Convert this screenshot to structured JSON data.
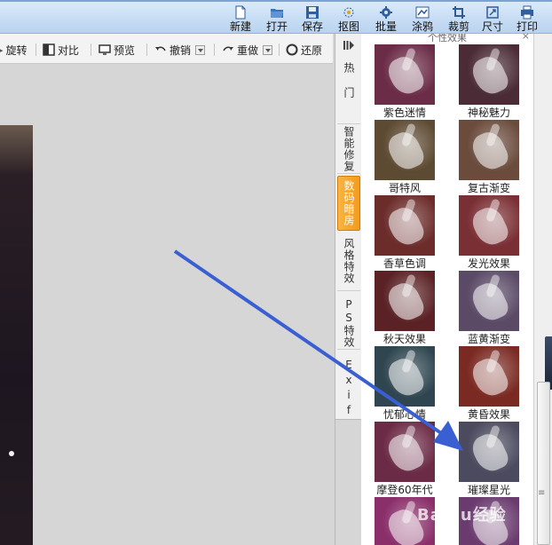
{
  "toolbar": {
    "buttons": [
      {
        "label": "新建",
        "icon": "new-file-icon"
      },
      {
        "label": "打开",
        "icon": "folder-icon"
      },
      {
        "label": "保存",
        "icon": "save-icon"
      },
      {
        "label": "抠图",
        "icon": "cutout-icon"
      },
      {
        "label": "批量",
        "icon": "gear-icon"
      },
      {
        "label": "涂鸦",
        "icon": "doodle-icon"
      },
      {
        "label": "裁剪",
        "icon": "crop-icon"
      },
      {
        "label": "尺寸",
        "icon": "resize-icon"
      },
      {
        "label": "打印",
        "icon": "printer-icon"
      }
    ]
  },
  "edit_toolbar": {
    "rotate": "旋转",
    "compare": "对比",
    "preview": "预览",
    "undo": "撤销",
    "redo": "重做",
    "restore": "还原"
  },
  "side_tabs": {
    "tabs": [
      {
        "label": "热门"
      },
      {
        "label": "智能修复"
      },
      {
        "label": "数码暗房",
        "active": true
      },
      {
        "label": "风格特效"
      },
      {
        "label": "PS特效"
      },
      {
        "label": "Exif"
      }
    ]
  },
  "effects_panel": {
    "title": "个性效果",
    "effects": [
      {
        "label": "紫色迷情",
        "color": "#6b2c47"
      },
      {
        "label": "神秘魅力",
        "color": "#4a2b36"
      },
      {
        "label": "哥特风",
        "color": "#5d4a32"
      },
      {
        "label": "复古渐变",
        "color": "#6a4b3c"
      },
      {
        "label": "香草色调",
        "color": "#6b2c2a"
      },
      {
        "label": "发光效果",
        "color": "#7a2f34"
      },
      {
        "label": "秋天效果",
        "color": "#5a2225"
      },
      {
        "label": "蓝黄渐变",
        "color": "#5b4a66"
      },
      {
        "label": "忧郁心情",
        "color": "#2f4650"
      },
      {
        "label": "黄昏效果",
        "color": "#7a2a22"
      },
      {
        "label": "摩登60年代",
        "color": "#6b2a45"
      },
      {
        "label": "璀璨星光",
        "color": "#4b4a5e"
      },
      {
        "label": "",
        "color": "#8a2f6a"
      },
      {
        "label": "",
        "color": "#6a3b6e"
      }
    ]
  },
  "watermark": "Baidu经验",
  "colors": {
    "accent_tab": "#f39a1d",
    "arrow": "#3a5fd3",
    "toolbar_bg": "#c9ddf4"
  }
}
